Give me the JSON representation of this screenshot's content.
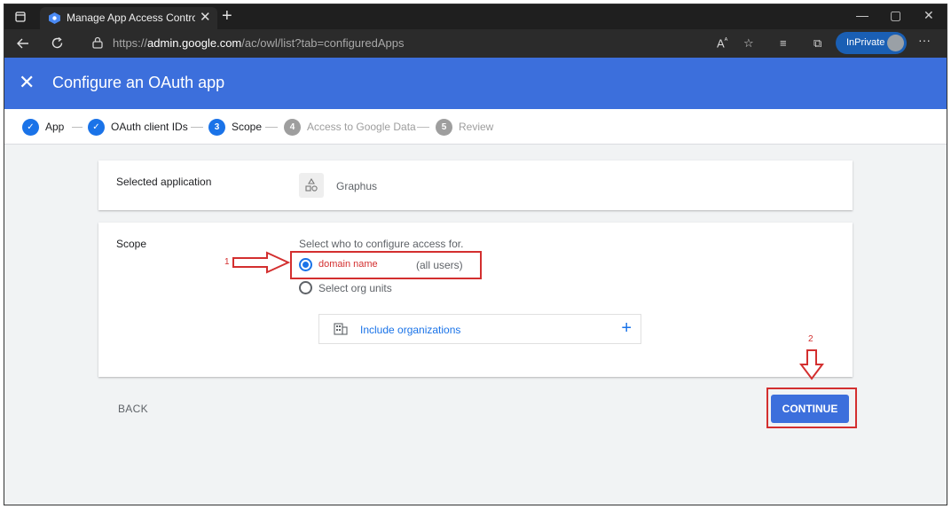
{
  "browser": {
    "tab_title": "Manage App Access Control - Ac",
    "tab_close": "✕",
    "new_tab": "+",
    "url_host": "admin.google.com",
    "url_scheme": "https://",
    "url_path": "/ac/owl/list?tab=configuredApps",
    "inprivate_label": "InPrivate",
    "window_controls": [
      "—",
      "▢",
      "✕"
    ],
    "more": "···"
  },
  "header": {
    "close_glyph": "✕",
    "title": "Configure an OAuth app"
  },
  "stepper": {
    "steps": [
      {
        "label": "App",
        "state": "done"
      },
      {
        "label": "OAuth client IDs",
        "state": "done"
      },
      {
        "label": "Scope",
        "number": "3",
        "state": "active"
      },
      {
        "label": "Access to Google Data",
        "number": "4",
        "state": "future"
      },
      {
        "label": "Review",
        "number": "5",
        "state": "future"
      }
    ],
    "check_glyph": "✓"
  },
  "selected_application": {
    "label": "Selected application",
    "app_name": "Graphus"
  },
  "scope": {
    "label": "Scope",
    "hint": "Select who to configure access for.",
    "option_domain": "domain name",
    "option_domain_note": "(all users)",
    "option_org": "Select org units",
    "include_orgs": "Include organizations",
    "plus": "+"
  },
  "actions": {
    "back": "BACK",
    "continue": "CONTINUE"
  },
  "annotations": {
    "one": "1",
    "two": "2"
  },
  "colors": {
    "accent": "#3c6fdc",
    "link": "#1a73e8",
    "annotation": "#d32f2f"
  }
}
